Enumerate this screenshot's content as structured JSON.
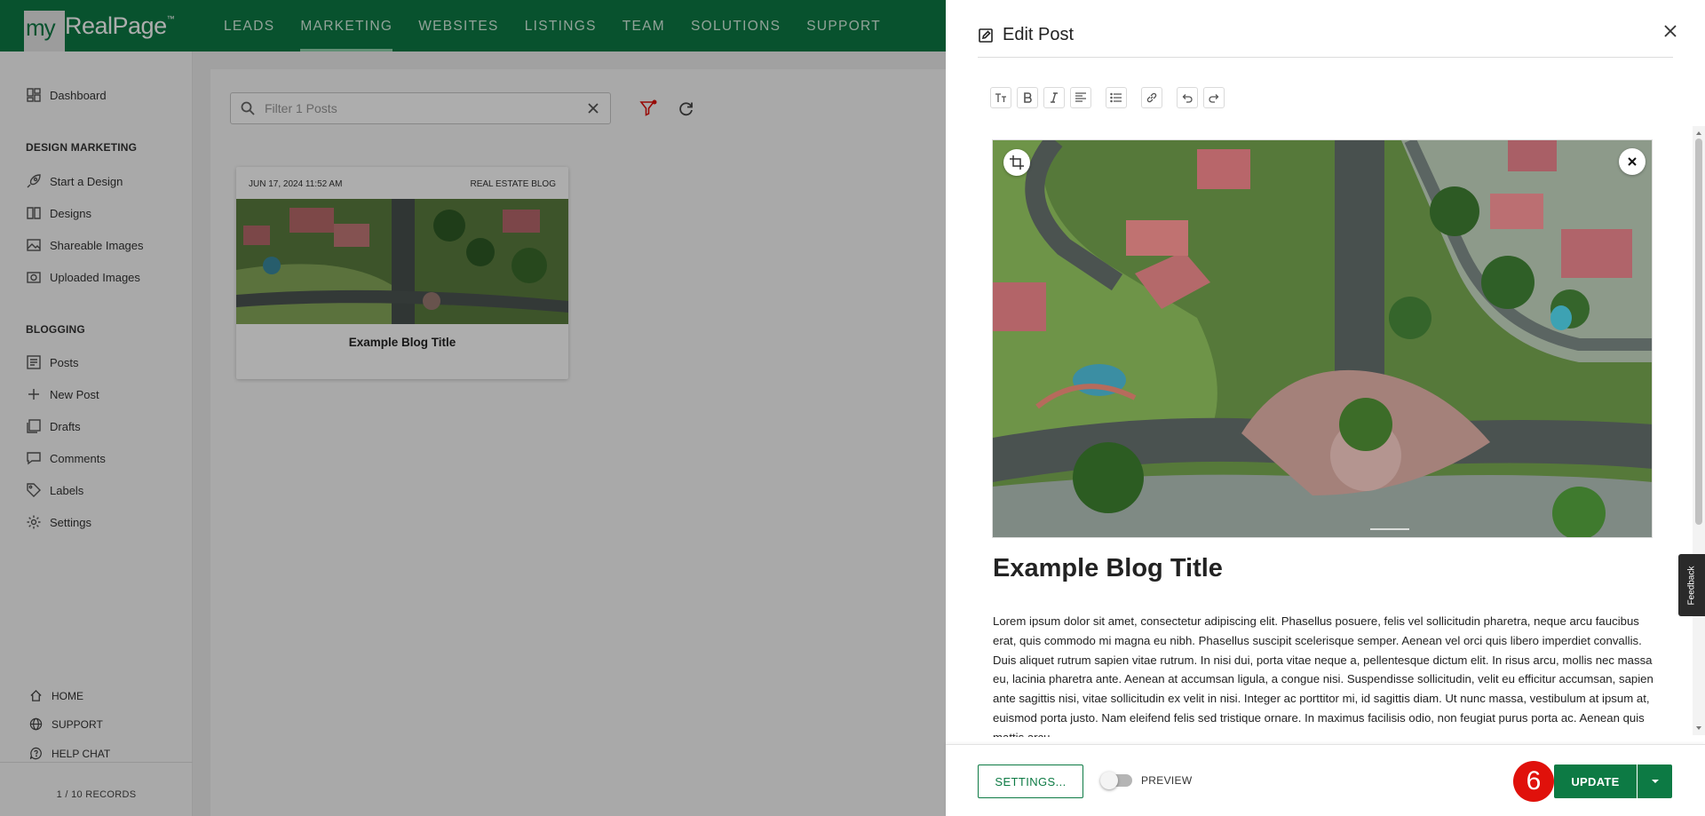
{
  "app": {
    "logo_my": "my",
    "logo_rest": "RealPage",
    "logo_tm": "™"
  },
  "nav": {
    "items": [
      {
        "label": "LEADS"
      },
      {
        "label": "MARKETING",
        "active": true
      },
      {
        "label": "WEBSITES"
      },
      {
        "label": "LISTINGS"
      },
      {
        "label": "TEAM"
      },
      {
        "label": "SOLUTIONS"
      },
      {
        "label": "SUPPORT"
      }
    ]
  },
  "sidebar": {
    "dashboard": "Dashboard",
    "design_heading": "DESIGN MARKETING",
    "start_design": "Start a Design",
    "designs": "Designs",
    "shareable_images": "Shareable Images",
    "uploaded_images": "Uploaded Images",
    "blogging_heading": "BLOGGING",
    "posts": "Posts",
    "new_post": "New Post",
    "drafts": "Drafts",
    "comments": "Comments",
    "labels": "Labels",
    "settings": "Settings",
    "home": "HOME",
    "support": "SUPPORT",
    "help_chat": "HELP CHAT",
    "records": "1 / 10 RECORDS"
  },
  "main": {
    "filter_placeholder": "Filter 1 Posts",
    "card": {
      "date": "JUN 17, 2024 11:52 AM",
      "category": "REAL ESTATE BLOG",
      "title": "Example Blog Title"
    }
  },
  "drawer": {
    "title": "Edit Post",
    "toolbar_icons": [
      "text-size-icon",
      "bold-icon",
      "italic-icon",
      "align-left-icon",
      "list-icon",
      "link-icon",
      "undo-icon",
      "redo-icon"
    ],
    "post_title": "Example Blog Title",
    "post_body": "Lorem ipsum dolor sit amet, consectetur adipiscing elit. Phasellus posuere, felis vel sollicitudin pharetra, neque arcu faucibus erat, quis commodo mi magna eu nibh. Phasellus suscipit scelerisque semper. Aenean vel orci quis libero imperdiet convallis. Duis aliquet rutrum sapien vitae rutrum. In nisi dui, porta vitae neque a, pellentesque dictum elit. In risus arcu, mollis nec massa eu, lacinia pharetra ante. Aenean at accumsan ligula, a congue nisi. Suspendisse sollicitudin, velit eu efficitur accumsan, sapien ante sagittis nisi, vitae sollicitudin ex velit in nisi. Integer ac porttitor mi, id sagittis diam. Ut nunc massa, vestibulum at ipsum at, euismod porta justo. Nam eleifend felis sed tristique ornare. In maximus facilisis odio, non feugiat purus porta ac. Aenean quis mattis arcu.",
    "footer": {
      "settings_label": "SETTINGS...",
      "preview_label": "PREVIEW",
      "preview_on": false,
      "step_number": "6",
      "update_label": "UPDATE"
    }
  },
  "feedback_label": "Feedback",
  "colors": {
    "brand_green": "#0d7a44",
    "step_badge_red": "#e0110b"
  }
}
